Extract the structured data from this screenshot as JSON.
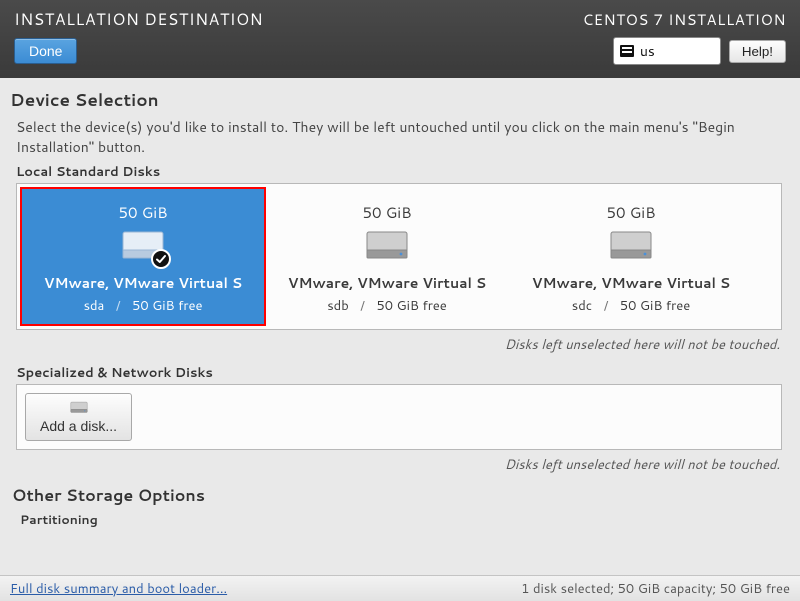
{
  "header": {
    "title_left": "INSTALLATION DESTINATION",
    "title_right": "CENTOS 7 INSTALLATION",
    "done_label": "Done",
    "keyboard_layout": "us",
    "help_label": "Help!"
  },
  "device_selection": {
    "title": "Device Selection",
    "description": "Select the device(s) you'd like to install to.  They will be left untouched until you click on the main menu's \"Begin Installation\" button.",
    "local_label": "Local Standard Disks",
    "hint": "Disks left unselected here will not be touched.",
    "disks": [
      {
        "size": "50 GiB",
        "name": "VMware, VMware Virtual S",
        "dev": "sda",
        "free": "50 GiB free",
        "selected": true
      },
      {
        "size": "50 GiB",
        "name": "VMware, VMware Virtual S",
        "dev": "sdb",
        "free": "50 GiB free",
        "selected": false
      },
      {
        "size": "50 GiB",
        "name": "VMware, VMware Virtual S",
        "dev": "sdc",
        "free": "50 GiB free",
        "selected": false
      }
    ]
  },
  "network_disks": {
    "label": "Specialized & Network Disks",
    "add_label": "Add a disk...",
    "hint": "Disks left unselected here will not be touched."
  },
  "other_storage": {
    "title": "Other Storage Options",
    "partitioning_label": "Partitioning"
  },
  "footer": {
    "link": "Full disk summary and boot loader...",
    "status": "1 disk selected; 50 GiB capacity; 50 GiB free"
  }
}
